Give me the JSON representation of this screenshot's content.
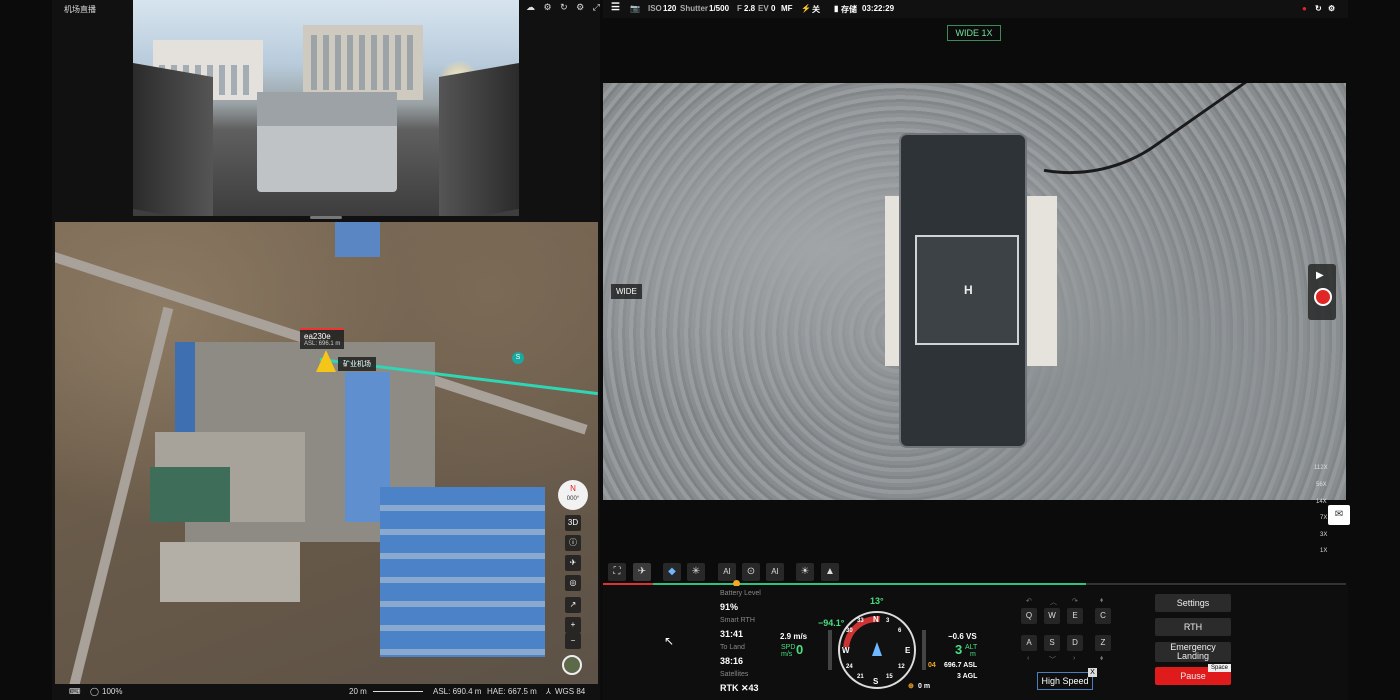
{
  "left": {
    "title": "机场直播",
    "top_icons": "☁ ⚙ ↻ ⚙ ⤢",
    "drone_name": "ea230e",
    "drone_asl": "ASL: 696.1 m",
    "dock_name": "矿业机场",
    "route_badge": "S",
    "compass_n": "N",
    "compass_val": "000°",
    "map_buttons": [
      "3D",
      "ⓘ",
      "✈",
      "◎",
      "↗",
      "+",
      "−"
    ],
    "status": {
      "battery_pct": "100%",
      "scale": "20 m",
      "asl": "ASL: 690.4 m",
      "hae": "HAE: 667.5 m",
      "datum": "WGS 84"
    }
  },
  "camera": {
    "iso_label": "ISO",
    "iso": "120",
    "shutter_label": "Shutter",
    "shutter": "1/500",
    "f_label": "F",
    "f": "2.8",
    "ev_label": "EV",
    "ev": "0",
    "mf": "MF",
    "shutter_mode": "关",
    "storage": "存储",
    "time": "03:22:29",
    "lens_badge": "WIDE 1X",
    "side_label": "WIDE",
    "zoom_levels": [
      "112X",
      "56X",
      "14X",
      "7X",
      "3X",
      "1X"
    ]
  },
  "tools": [
    "⛶",
    "✈",
    "◆",
    "✳",
    "AI",
    "⊙",
    "AI",
    "☀",
    "▲"
  ],
  "flight": {
    "battery_label": "Battery Level",
    "battery": "91%",
    "smart_rth_label": "Smart RTH",
    "smart_rth": "31:41",
    "to_land_label": "To Land",
    "to_land": "38:16",
    "satellites_label": "Satellites",
    "satellites": "RTK ✕43",
    "heading": "13°",
    "pitch": "−94.1°",
    "hspeed": "2.9 m/s",
    "spd_label": "SPD",
    "spd_unit": "m/s",
    "spd": "0",
    "vs": "−0.6 VS",
    "alt": "3",
    "alt_label": "ALT",
    "alt_unit": "m",
    "asl": "696.7 ASL",
    "agl": "3 AGL",
    "dist": "0 m",
    "ladder_val": "04",
    "cardinals": [
      "N",
      "E",
      "S",
      "W"
    ],
    "ticks": [
      "3",
      "6",
      "12",
      "15",
      "21",
      "24",
      "30",
      "33"
    ]
  },
  "keys": {
    "row1": [
      "Q",
      "W",
      "E",
      "C"
    ],
    "row2": [
      "A",
      "S",
      "D",
      "Z"
    ],
    "speed_mode": "High Speed",
    "close": "X"
  },
  "actions": {
    "settings": "Settings",
    "rth": "RTH",
    "emergency_1": "Emergency",
    "emergency_2": "Landing",
    "pause": "Pause",
    "space": "Space"
  },
  "progress": 0.65
}
